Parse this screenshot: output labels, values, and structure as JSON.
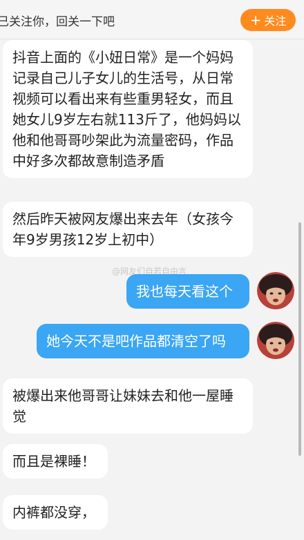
{
  "header": {
    "notice_text": "已关注你，回关一下吧",
    "follow_button_label": "关注",
    "follow_button_icon": "plus-icon"
  },
  "messages": [
    {
      "side": "left",
      "text": "抖音上面的《小妞日常》是一个妈妈记录自己儿子女儿的生活号，从日常视频可以看出来有些重男轻女，而且她女儿9岁左右就113斤了，他妈妈以他和他哥哥吵架此为流量密码，作品中好多次都故意制造矛盾"
    },
    {
      "side": "left",
      "text": "然后昨天被网友爆出来去年（女孩今年9岁男孩12岁上初中）"
    },
    {
      "side": "right",
      "text": "我也每天看这个"
    },
    {
      "side": "right",
      "text": "她今天不是吧作品都清空了吗"
    },
    {
      "side": "left",
      "text": "被爆出来他哥哥让妹妹去和他一屋睡觉"
    },
    {
      "side": "left",
      "text": "而且是裸睡！"
    },
    {
      "side": "left",
      "text": "内裤都没穿，"
    }
  ],
  "colors": {
    "accent_orange": "#ff8a1e",
    "sent_bubble": "#3ba6f3",
    "received_bubble": "#ffffff",
    "background": "#f3f3f3"
  },
  "watermark_text": "@网友们自若自由言"
}
